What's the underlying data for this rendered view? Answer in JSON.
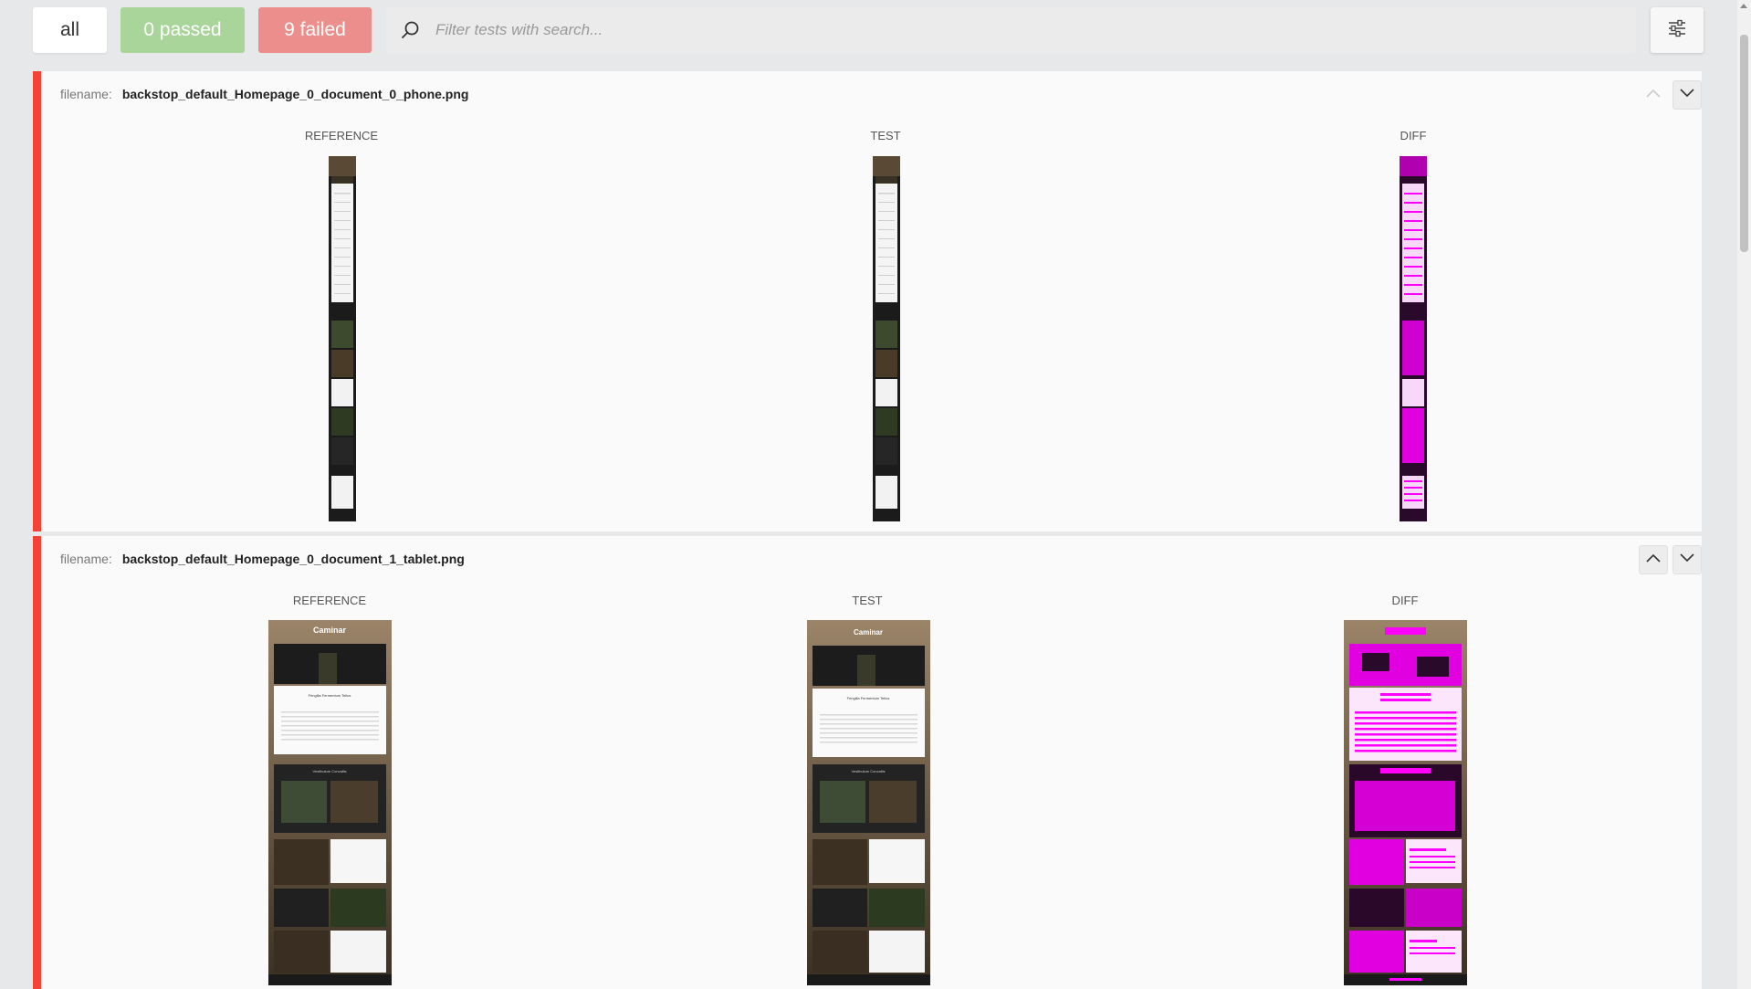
{
  "filters": {
    "all_label": "all",
    "passed_label": "0 passed",
    "failed_label": "9 failed",
    "search_placeholder": "Filter tests with search..."
  },
  "icons": {
    "search": "search-icon",
    "settings": "sliders-icon",
    "up": "chevron-up-icon",
    "down": "chevron-down-icon"
  },
  "colors": {
    "passed": "#a9d49a",
    "failed": "#ec8f8c",
    "fail_bar": "#f44336",
    "diff": "#ff00ff"
  },
  "tests": [
    {
      "filename_label": "filename:",
      "filename": "backstop_default_Homepage_0_document_0_phone.png",
      "reference_label": "REFERENCE",
      "test_label": "TEST",
      "diff_label": "DIFF"
    },
    {
      "filename_label": "filename:",
      "filename": "backstop_default_Homepage_0_document_1_tablet.png",
      "reference_label": "REFERENCE",
      "test_label": "TEST",
      "diff_label": "DIFF",
      "thumb_title": "Caminar",
      "thumb_heading_1": "Fringilla Fermentum Tellus",
      "thumb_heading_2": "Vestibulum Convallis"
    }
  ]
}
